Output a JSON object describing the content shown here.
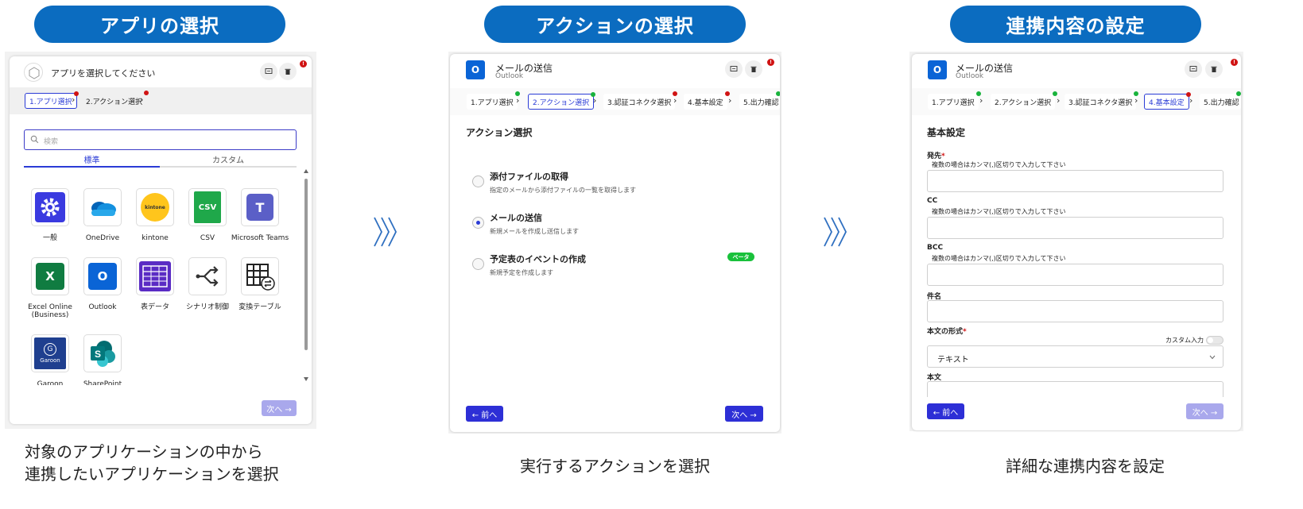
{
  "section1": {
    "pill": "アプリの選択",
    "caption_line1": "対象のアプリケーションの中から",
    "caption_line2": "連携したいアプリケーションを選択",
    "header_title": "アプリを選択してください",
    "steps": [
      "1.アプリ選択",
      "2.アクション選択"
    ],
    "search_placeholder": "検索",
    "tabs": [
      "標準",
      "カスタム"
    ],
    "apps": [
      {
        "label": "一般",
        "icon": "gear-icon"
      },
      {
        "label": "OneDrive",
        "icon": "onedrive-icon"
      },
      {
        "label": "kintone",
        "icon": "kintone-icon",
        "logo_text": "kintone"
      },
      {
        "label": "CSV",
        "icon": "csv-icon",
        "logo_text": "CSV"
      },
      {
        "label": "Microsoft Teams",
        "icon": "teams-icon",
        "logo_text": "T"
      },
      {
        "label": "Excel Online (Business)",
        "icon": "excel-icon",
        "logo_text": "X"
      },
      {
        "label": "Outlook",
        "icon": "outlook-icon",
        "logo_text": "O"
      },
      {
        "label": "表データ",
        "icon": "table-data-icon"
      },
      {
        "label": "シナリオ制御",
        "icon": "scenario-icon"
      },
      {
        "label": "変換テーブル",
        "icon": "convert-table-icon"
      },
      {
        "label": "Garoon",
        "icon": "garoon-icon",
        "logo_text": "G",
        "sub_text": "Garoon"
      },
      {
        "label": "SharePoint",
        "icon": "sharepoint-icon",
        "logo_text": "S"
      }
    ],
    "next_button": "次へ →"
  },
  "section2": {
    "pill": "アクションの選択",
    "caption": "実行するアクションを選択",
    "header_title": "メールの送信",
    "header_subtitle": "Outlook",
    "steps": [
      "1.アプリ選択",
      "2.アクション選択",
      "3.認証コネクタ選択",
      "4.基本設定",
      "5.出力確認"
    ],
    "section_title": "アクション選択",
    "options": [
      {
        "title": "添付ファイルの取得",
        "desc": "指定のメールから添付ファイルの一覧を取得します",
        "selected": false
      },
      {
        "title": "メールの送信",
        "desc": "新規メールを作成し送信します",
        "selected": true
      },
      {
        "title": "予定表のイベントの作成",
        "desc": "新規予定を作成します",
        "selected": false,
        "badge": "ベータ"
      }
    ],
    "prev_button": "← 前へ",
    "next_button": "次へ →"
  },
  "section3": {
    "pill": "連携内容の設定",
    "caption": "詳細な連携内容を設定",
    "header_title": "メールの送信",
    "header_subtitle": "Outlook",
    "steps": [
      "1.アプリ選択",
      "2.アクション選択",
      "3.認証コネクタ選択",
      "4.基本設定",
      "5.出力確認"
    ],
    "section_title": "基本設定",
    "fields": {
      "to_label": "発先",
      "to_help": "複数の場合はカンマ(,)区切りで入力して下さい",
      "cc_label": "CC",
      "cc_help": "複数の場合はカンマ(,)区切りで入力して下さい",
      "bcc_label": "BCC",
      "bcc_help": "複数の場合はカンマ(,)区切りで入力して下さい",
      "subject_label": "件名",
      "format_label": "本文の形式",
      "custom_input_label": "カスタム入力",
      "format_value": "テキスト",
      "body_label": "本文"
    },
    "required_mark": "*",
    "prev_button": "← 前へ",
    "next_button": "次へ →"
  },
  "colors": {
    "pill": "#0b6cc0",
    "primary": "#2d2fd6",
    "error": "#d01313",
    "success": "#19b33c"
  }
}
